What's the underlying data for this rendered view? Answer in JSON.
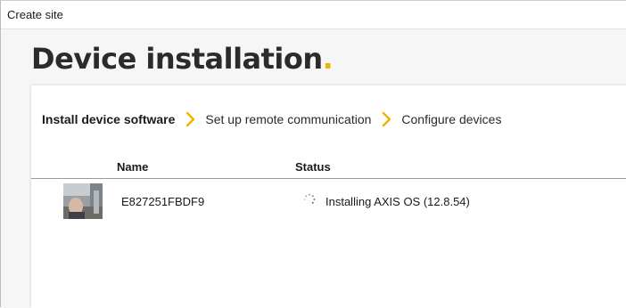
{
  "window": {
    "title": "Create site"
  },
  "page": {
    "title": "Device installation",
    "title_dot": "."
  },
  "colors": {
    "accent": "#f2b300"
  },
  "stepper": {
    "steps": [
      {
        "label": "Install device software",
        "active": true
      },
      {
        "label": "Set up remote communication",
        "active": false
      },
      {
        "label": "Configure devices",
        "active": false
      }
    ],
    "separator_icon": "chevron-right-icon"
  },
  "table": {
    "columns": [
      "Name",
      "Status"
    ],
    "rows": [
      {
        "thumbnail_icon": "camera-snapshot-thumbnail",
        "name": "E827251FBDF9",
        "status_icon": "loading-spinner-icon",
        "status": "Installing AXIS OS (12.8.54)"
      }
    ]
  }
}
